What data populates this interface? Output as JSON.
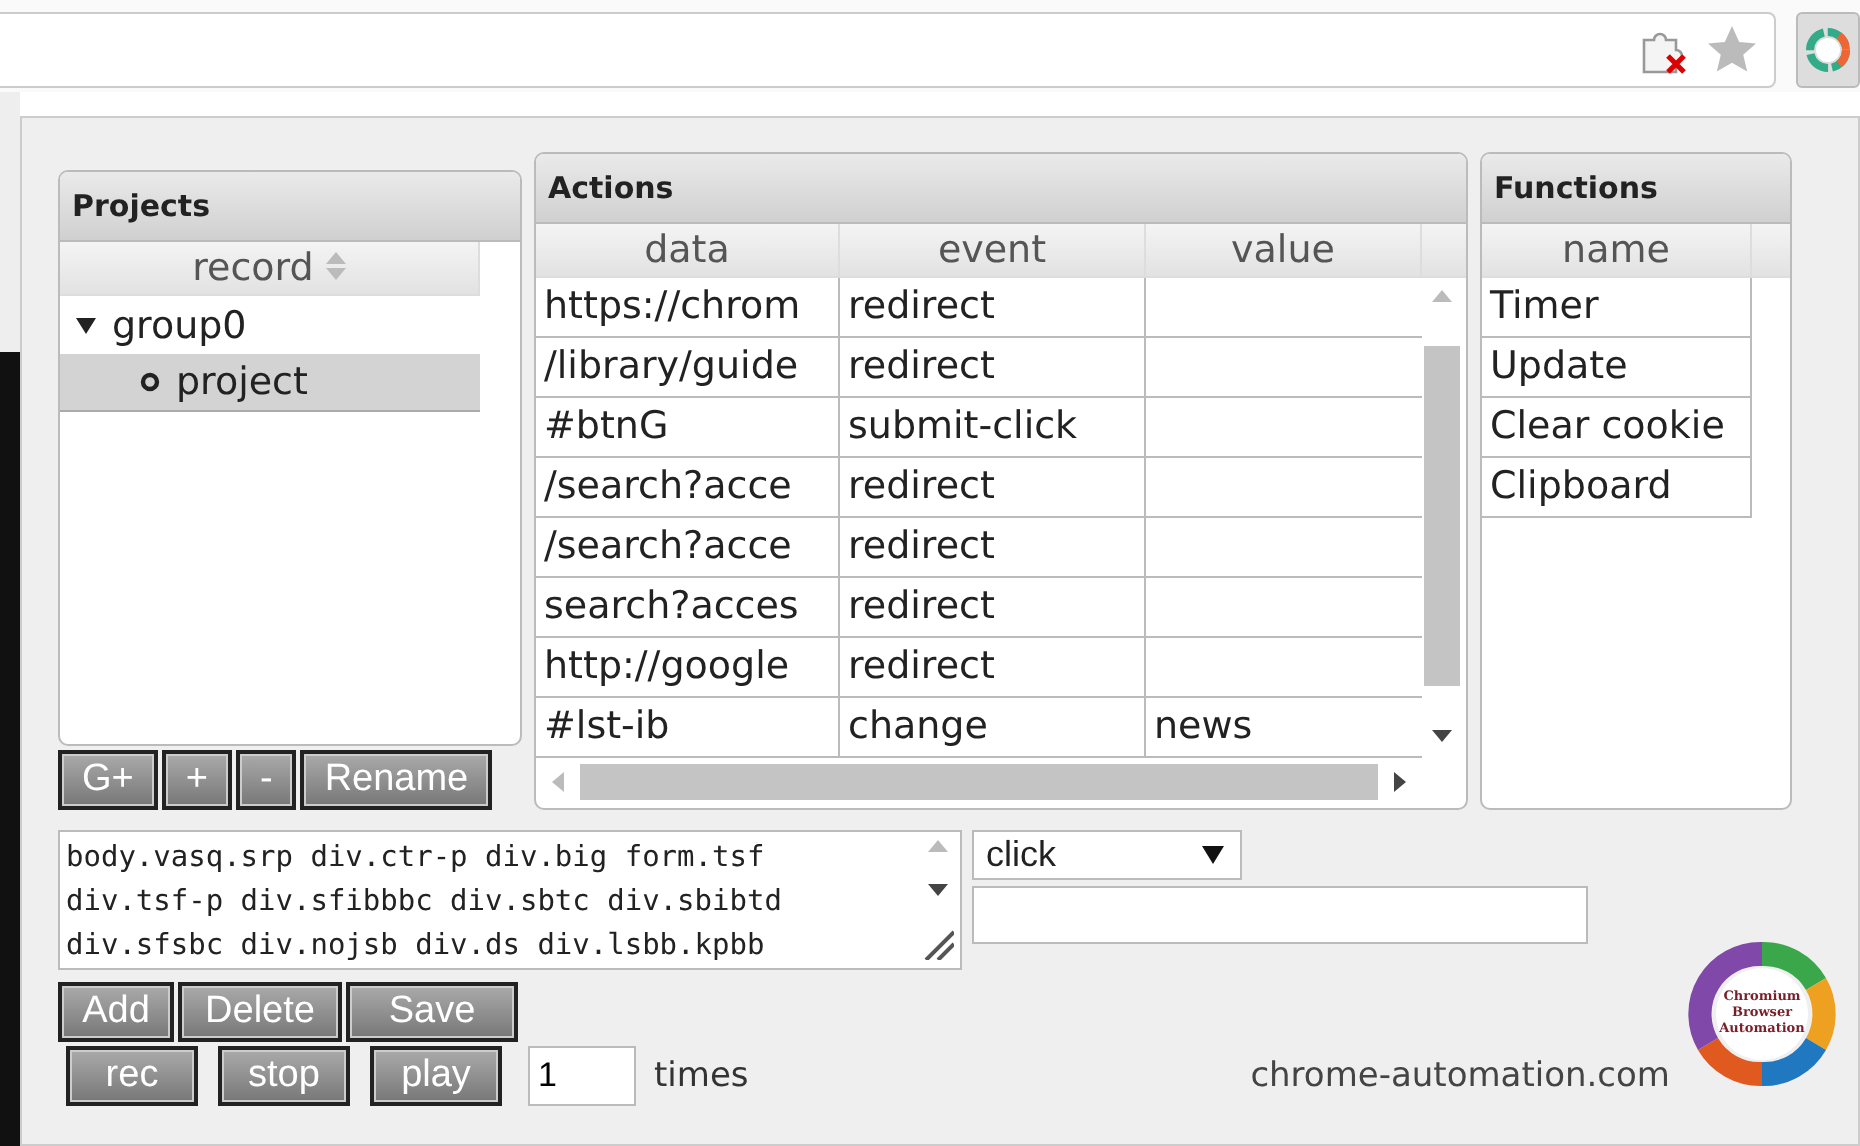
{
  "projects": {
    "title": "Projects",
    "column": "record",
    "tree": [
      {
        "label": "group0",
        "expanded": true,
        "selected": false,
        "children": [
          {
            "label": "project",
            "selected": true
          }
        ]
      }
    ]
  },
  "project_buttons": [
    "G+",
    "+",
    "-",
    "Rename"
  ],
  "actions": {
    "title": "Actions",
    "columns": [
      "data",
      "event",
      "value"
    ],
    "rows": [
      {
        "data": "https://chrom",
        "event": "redirect"
      },
      {
        "data": "/library/guide",
        "event": "redirect"
      },
      {
        "data": "#btnG",
        "event": "submit-click"
      },
      {
        "data": "/search?acce",
        "event": "redirect"
      },
      {
        "data": "/search?acce",
        "event": "redirect"
      },
      {
        "data": "search?acces",
        "event": "redirect"
      },
      {
        "data": "http://google",
        "event": "redirect"
      },
      {
        "data": "#lst-ib",
        "event": "change",
        "value": "news"
      }
    ]
  },
  "functions": {
    "title": "Functions",
    "column": "name",
    "rows": [
      "Timer",
      "Update",
      "Clear cookie",
      "Clipboard"
    ]
  },
  "selector": {
    "lines": [
      "body.vasq.srp div.ctr-p div.big form.tsf",
      "div.tsf-p div.sfibbbc div.sbtc div.sbibtd",
      "div.sfsbc div.nojsb div.ds div.lsbb.kpbb"
    ]
  },
  "event_select": {
    "value": "click"
  },
  "action_buttons": [
    "Add",
    "Delete",
    "Save"
  ],
  "play_buttons": [
    "rec",
    "stop",
    "play"
  ],
  "repeat": {
    "value": "1",
    "suffix": "times"
  },
  "footer_link": "chrome-automation.com",
  "logo": {
    "lines": [
      "Chromium",
      "Browser",
      "Automation"
    ]
  }
}
